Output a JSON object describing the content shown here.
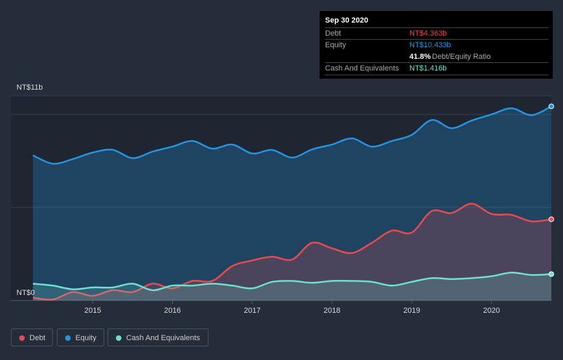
{
  "tooltip": {
    "date": "Sep 30 2020",
    "debt_label": "Debt",
    "debt_value": "NT$4.363b",
    "equity_label": "Equity",
    "equity_value": "NT$10.433b",
    "ratio_value": "41.8%",
    "ratio_label": "Debt/Equity Ratio",
    "cash_label": "Cash And Equivalents",
    "cash_value": "NT$1.416b"
  },
  "legend": [
    {
      "label": "Debt"
    },
    {
      "label": "Equity"
    },
    {
      "label": "Cash And Equivalents"
    }
  ],
  "chart_data": {
    "type": "area",
    "y_top_label": "NT$11b",
    "y_bottom_label": "NT$0",
    "ylim": [
      0,
      11
    ],
    "xlim": [
      2014.25,
      2020.75
    ],
    "x_ticks": [
      "2015",
      "2016",
      "2017",
      "2018",
      "2019",
      "2020"
    ],
    "x": [
      2014.25,
      2014.5,
      2014.75,
      2015,
      2015.25,
      2015.5,
      2015.75,
      2016,
      2016.25,
      2016.5,
      2016.75,
      2017,
      2017.25,
      2017.5,
      2017.75,
      2018,
      2018.25,
      2018.5,
      2018.75,
      2019,
      2019.25,
      2019.5,
      2019.75,
      2020,
      2020.25,
      2020.5,
      2020.75
    ],
    "series": [
      {
        "name": "Equity",
        "color": "#2394df",
        "values": [
          7.8,
          7.35,
          7.6,
          7.95,
          8.1,
          7.65,
          8.0,
          8.27,
          8.57,
          8.16,
          8.38,
          7.9,
          8.09,
          7.68,
          8.12,
          8.38,
          8.71,
          8.27,
          8.57,
          8.9,
          9.7,
          9.26,
          9.67,
          10.0,
          10.33,
          9.96,
          10.433
        ]
      },
      {
        "name": "Debt",
        "color": "#e64b50",
        "values": [
          0.15,
          0.05,
          0.45,
          0.25,
          0.55,
          0.45,
          0.9,
          0.65,
          1.05,
          1.05,
          1.85,
          2.15,
          2.35,
          2.2,
          3.1,
          2.8,
          2.55,
          3.1,
          3.75,
          3.65,
          4.8,
          4.7,
          5.2,
          4.65,
          4.6,
          4.25,
          4.363
        ]
      },
      {
        "name": "Cash And Equivalents",
        "color": "#6de0d2",
        "values": [
          0.9,
          0.8,
          0.6,
          0.7,
          0.7,
          0.9,
          0.55,
          0.8,
          0.8,
          0.9,
          0.8,
          0.65,
          1.0,
          1.05,
          0.95,
          1.05,
          1.05,
          1.0,
          0.8,
          1.0,
          1.2,
          1.15,
          1.2,
          1.3,
          1.5,
          1.37,
          1.416
        ]
      }
    ]
  }
}
